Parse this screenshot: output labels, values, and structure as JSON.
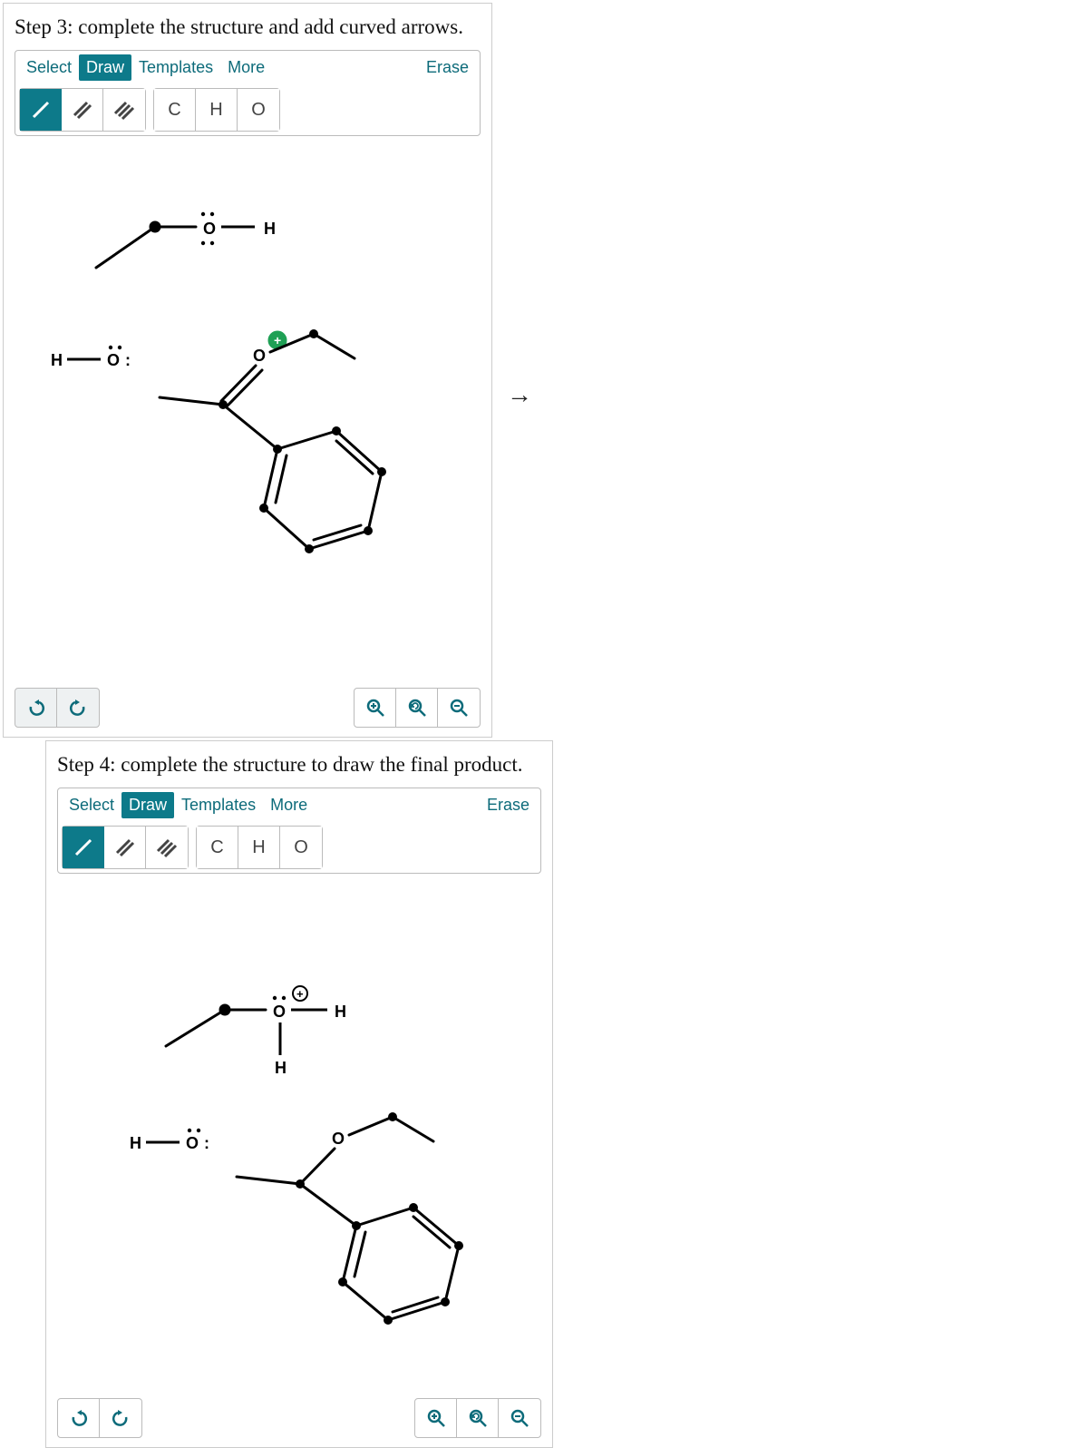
{
  "panels": [
    {
      "instruction": "Step 3: complete the structure and add curved arrows.",
      "tabs": {
        "select": "Select",
        "draw": "Draw",
        "templates": "Templates",
        "more": "More",
        "erase": "Erase"
      },
      "atoms": {
        "c": "C",
        "h": "H",
        "o": "O"
      }
    },
    {
      "instruction": "Step 4: complete the structure to draw the final product.",
      "tabs": {
        "select": "Select",
        "draw": "Draw",
        "templates": "Templates",
        "more": "More",
        "erase": "Erase"
      },
      "atoms": {
        "c": "C",
        "h": "H",
        "o": "O"
      }
    }
  ],
  "between_arrow": "→",
  "mol_labels": {
    "O": "O",
    "H": "H",
    "plus": "+"
  }
}
